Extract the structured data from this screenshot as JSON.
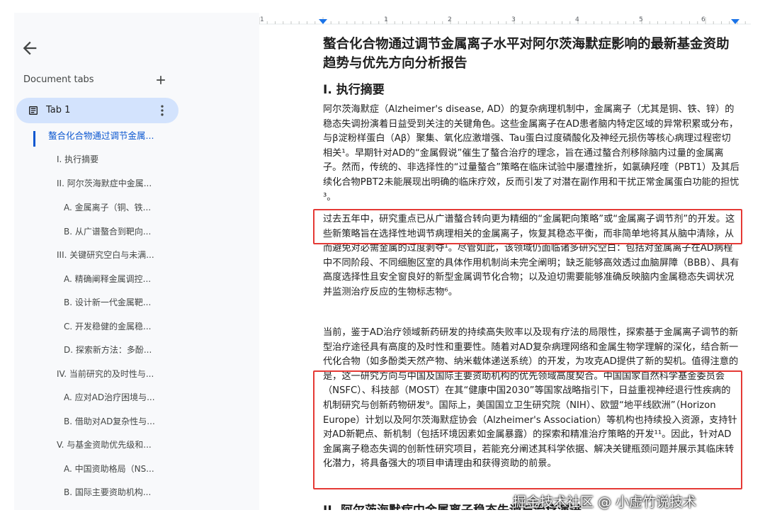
{
  "sidebar": {
    "tabs_title": "Document tabs",
    "tab_label": "Tab 1",
    "outline": [
      "螯合化合物通过调节金属...",
      "I. 执行摘要",
      "II. 阿尔茨海默症中金属...",
      "A. 金属离子（铜、铁...",
      "B. 从广谱螯合到靶向...",
      "III. 关键研究空白与未满...",
      "A. 精确阐释金属调控...",
      "B. 设计新一代金属靶...",
      "C. 开发稳健的金属稳...",
      "D. 探索新方法：多酚...",
      "IV. 当前研究的及时性与...",
      "A. 应对AD治疗困境与...",
      "B. 借助对AD复杂性与...",
      "V. 与基金资助优先级和...",
      "A. 中国资助格局（NS...",
      "B. 国际主要资助机构..."
    ]
  },
  "ruler": {
    "numbers": [
      "1",
      "1",
      "2",
      "3",
      "4",
      "5",
      "6"
    ]
  },
  "doc": {
    "title": "螯合化合物通过调节金属离子水平对阿尔茨海默症影响的最新基金资助趋势与优先方向分析报告",
    "h_exec": "I. 执行摘要",
    "p1": "阿尔茨海默症（Alzheimer's disease, AD）的复杂病理机制中，金属离子（尤其是铜、铁、锌）的稳态失调扮演着日益受到关注的关键角色。这些金属离子在AD患者脑内特定区域的异常积累或分布，与β淀粉样蛋白（Aβ）聚集、氧化应激增强、Tau蛋白过度磷酸化及神经元损伤等核心病理过程密切相关¹。早期针对AD的“金属假说”催生了螯合治疗的理念，旨在通过螯合剂移除脑内过量的金属离子。然而，传统的、非选择性的“过量螯合”策略在临床试验中屡遭挫折，如氯碘羟喹（PBT1）及其后续化合物PBT2未能展现出明确的临床疗效，反而引发了对潜在副作用和干扰正常金属蛋白功能的担忧³。",
    "p2": "过去五年中，研究重点已从广谱螯合转向更为精细的“金属靶向策略”或“金属离子调节剂”的开发。这些新策略旨在选择性地调节病理相关的金属离子，恢复其稳态平衡，而非简单地将其从脑中清除，从而避免对必需金属的过度剥夺¹。尽管如此，该领域仍面临诸多研究空白：包括对金属离子在AD病程中不同阶段、不同细胞区室的具体作用机制尚未完全阐明；缺乏能够高效透过血脑屏障（BBB）、具有高度选择性且安全窗良好的新型金属调节化合物；以及迫切需要能够准确反映脑内金属稳态失调状况并监测治疗反应的生物标志物⁶。",
    "p3": "当前，鉴于AD治疗领域新药研发的持续高失败率以及现有疗法的局限性，探索基于金属离子调节的新型治疗途径具有高度的及时性和重要性。随着对AD复杂病理网络和金属生物学理解的深化，结合新一代化合物（如多酚类天然产物、纳米载体递送系统）的开发，为攻克AD提供了新的契机。值得注意的是，这一研究方向与中国及国际主要资助机构的优先领域高度契合。中国国家自然科学基金委员会（NSFC）、科技部（MOST）在其“健康中国2030”等国家战略指引下，日益重视神经退行性疾病的机制研究与创新药物研发⁹。国际上，美国国立卫生研究院（NIH）、欧盟“地平线欧洲”（Horizon Europe）计划以及阿尔茨海默症协会（Alzheimer's Association）等机构也持续投入资源，支持针对AD新靶点、新机制（包括环境因素如金属暴露）的探索和精准治疗策略的开发¹¹。因此，针对AD金属离子稳态失调的创新性研究项目，若能充分阐述其科学依据、解决关键瓶颈问题并展示其临床转化潜力，将具备强大的项目申请理由和获得资助的前景。",
    "h_next": "II. 阿尔茨海默症中金属离子稳态失调与治疗演进"
  },
  "watermark": "掘金技术社区 @ 小虚竹说技术",
  "colors": {
    "accent": "#0b57d0",
    "tab_bg": "#d3e3fd",
    "highlight": "#e53935"
  }
}
